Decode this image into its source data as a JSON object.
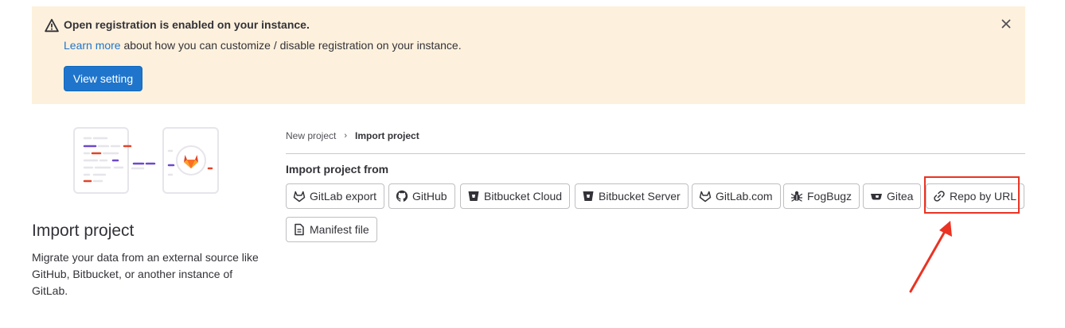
{
  "alert": {
    "title": "Open registration is enabled on your instance.",
    "link_text": "Learn more",
    "body_text": " about how you can customize / disable registration on your instance.",
    "button_label": "View setting",
    "icons": {
      "warning": "warning-icon",
      "close": "close-icon"
    }
  },
  "sidebar": {
    "title": "Import project",
    "description": "Migrate your data from an external source like GitHub, Bitbucket, or another instance of GitLab."
  },
  "breadcrumb": {
    "items": [
      "New project",
      "Import project"
    ]
  },
  "import": {
    "label": "Import project from",
    "sources": [
      {
        "label": "GitLab export",
        "icon": "tanuki-icon"
      },
      {
        "label": "GitHub",
        "icon": "github-icon"
      },
      {
        "label": "Bitbucket Cloud",
        "icon": "bitbucket-icon"
      },
      {
        "label": "Bitbucket Server",
        "icon": "bitbucket-icon"
      },
      {
        "label": "GitLab.com",
        "icon": "tanuki-icon"
      },
      {
        "label": "FogBugz",
        "icon": "bug-icon"
      },
      {
        "label": "Gitea",
        "icon": "gitea-icon"
      },
      {
        "label": "Repo by URL",
        "icon": "link-icon"
      },
      {
        "label": "Manifest file",
        "icon": "document-icon"
      }
    ]
  },
  "colors": {
    "alert_bg": "#fdf1dd",
    "primary": "#1f75cb",
    "annotation": "#ea3323",
    "text": "#333238"
  }
}
